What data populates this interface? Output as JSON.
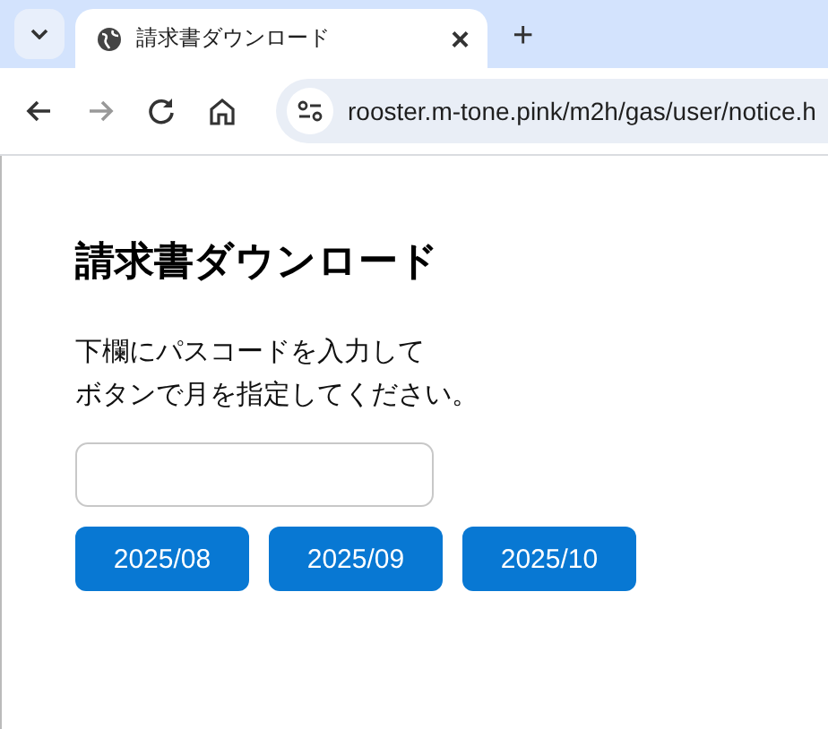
{
  "browser": {
    "tabs": [
      {
        "title": "請求書ダウンロード",
        "selected": true
      }
    ],
    "close_glyph": "×",
    "new_tab_glyph": "+",
    "address": "rooster.m-tone.pink/m2h/gas/user/notice.h"
  },
  "page": {
    "heading": "請求書ダウンロード",
    "instruction_lines": [
      "下欄にパスコードを入力して",
      "ボタンで月を指定してください。"
    ],
    "buttons": [
      "2025/08",
      "2025/09",
      "2025/10"
    ]
  }
}
